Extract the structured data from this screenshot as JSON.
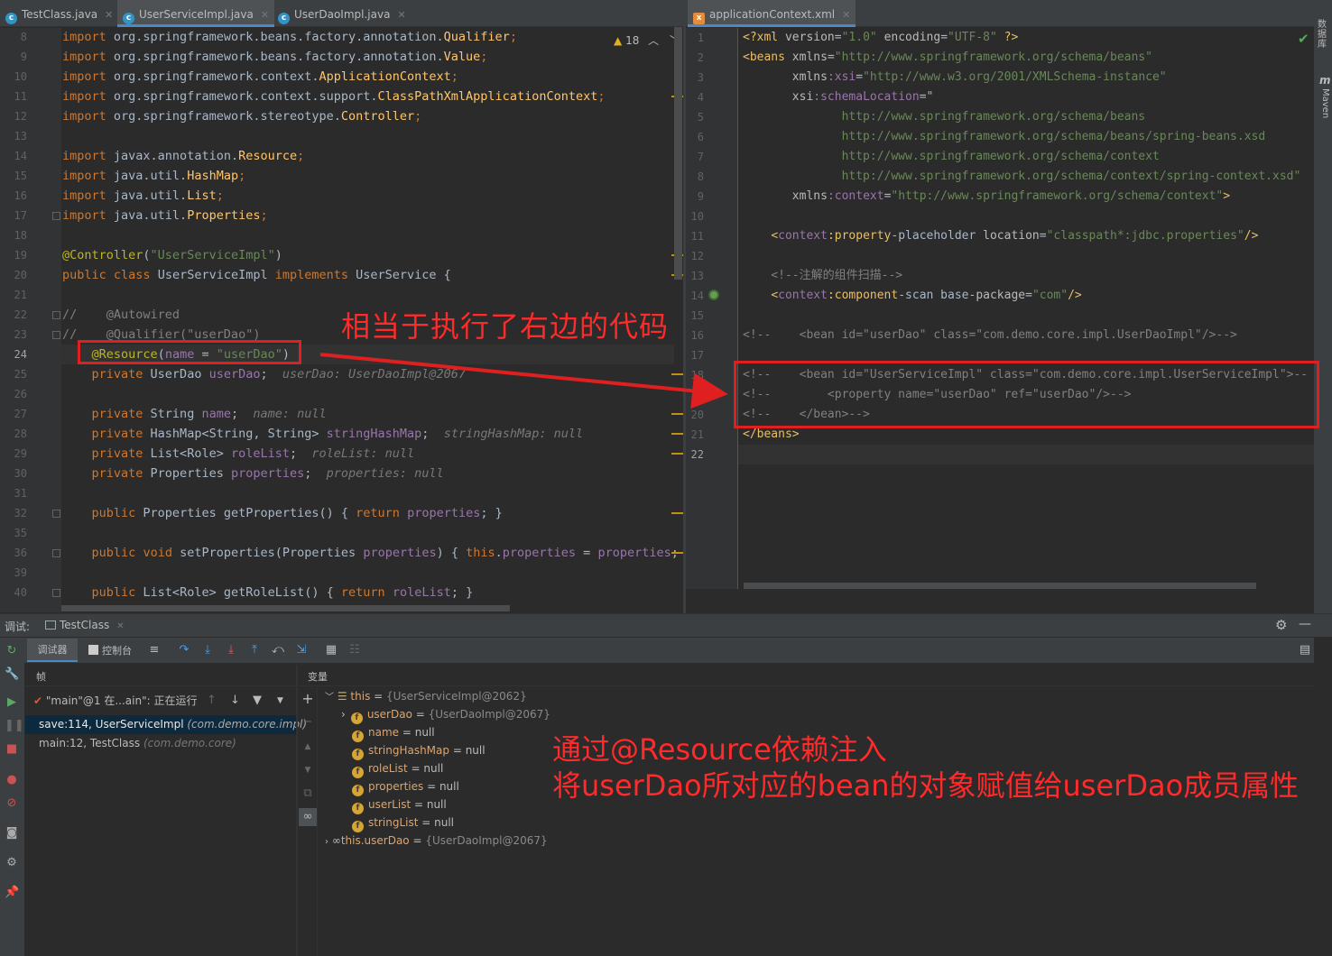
{
  "left_tabs": [
    {
      "label": "TestClass.java",
      "icon": "class-icon"
    },
    {
      "label": "UserServiceImpl.java",
      "icon": "class-icon",
      "active": true
    },
    {
      "label": "UserDaoImpl.java",
      "icon": "class-icon"
    }
  ],
  "right_tabs": [
    {
      "label": "applicationContext.xml",
      "icon": "xml-icon",
      "active": true
    }
  ],
  "warning_count": "18",
  "left_lines": [
    {
      "n": "8",
      "code": "import org.springframework.beans.factory.annotation.Qualifier;"
    },
    {
      "n": "9",
      "code": "import org.springframework.beans.factory.annotation.Value;"
    },
    {
      "n": "10",
      "code": "import org.springframework.context.ApplicationContext;"
    },
    {
      "n": "11",
      "code": "import org.springframework.context.support.ClassPathXmlApplicationContext;"
    },
    {
      "n": "12",
      "code": "import org.springframework.stereotype.Controller;"
    },
    {
      "n": "13",
      "code": ""
    },
    {
      "n": "14",
      "code": "import javax.annotation.Resource;"
    },
    {
      "n": "15",
      "code": "import java.util.HashMap;"
    },
    {
      "n": "16",
      "code": "import java.util.List;"
    },
    {
      "n": "17",
      "code": "import java.util.Properties;"
    },
    {
      "n": "18",
      "code": ""
    },
    {
      "n": "19",
      "code": "@Controller(\"UserServiceImpl\")"
    },
    {
      "n": "20",
      "code": "public class UserServiceImpl implements UserService {"
    },
    {
      "n": "21",
      "code": ""
    },
    {
      "n": "22",
      "code": "//    @Autowired"
    },
    {
      "n": "23",
      "code": "//    @Qualifier(\"userDao\")"
    },
    {
      "n": "24",
      "code": "    @Resource(name = \"userDao\")"
    },
    {
      "n": "25",
      "code": "    private UserDao userDao;",
      "hint": "userDao: UserDaoImpl@2067"
    },
    {
      "n": "26",
      "code": ""
    },
    {
      "n": "27",
      "code": "    private String name;",
      "hint": "name: null"
    },
    {
      "n": "28",
      "code": "    private HashMap<String, String> stringHashMap;",
      "hint": "stringHashMap: null"
    },
    {
      "n": "29",
      "code": "    private List<Role> roleList;",
      "hint": "roleList: null"
    },
    {
      "n": "30",
      "code": "    private Properties properties;",
      "hint": "properties: null"
    },
    {
      "n": "31",
      "code": ""
    },
    {
      "n": "32",
      "code": "    public Properties getProperties() { return properties; }"
    },
    {
      "n": "35",
      "code": ""
    },
    {
      "n": "36",
      "code": "    public void setProperties(Properties properties) { this.properties = properties; }"
    },
    {
      "n": "39",
      "code": ""
    },
    {
      "n": "40",
      "code": "    public List<Role> getRoleList() { return roleList; }"
    }
  ],
  "right_lines": [
    {
      "n": "1",
      "code": "<?xml version=\"1.0\" encoding=\"UTF-8\" ?>"
    },
    {
      "n": "2",
      "code": "<beans xmlns=\"http://www.springframework.org/schema/beans\""
    },
    {
      "n": "3",
      "code": "       xmlns:xsi=\"http://www.w3.org/2001/XMLSchema-instance\""
    },
    {
      "n": "4",
      "code": "       xsi:schemaLocation=\""
    },
    {
      "n": "5",
      "code": "              http://www.springframework.org/schema/beans"
    },
    {
      "n": "6",
      "code": "              http://www.springframework.org/schema/beans/spring-beans.xsd"
    },
    {
      "n": "7",
      "code": "              http://www.springframework.org/schema/context"
    },
    {
      "n": "8",
      "code": "              http://www.springframework.org/schema/context/spring-context.xsd\""
    },
    {
      "n": "9",
      "code": "       xmlns:context=\"http://www.springframework.org/schema/context\">"
    },
    {
      "n": "10",
      "code": ""
    },
    {
      "n": "11",
      "code": "    <context:property-placeholder location=\"classpath*:jdbc.properties\"/>"
    },
    {
      "n": "12",
      "code": ""
    },
    {
      "n": "13",
      "code": "    <!--注解的组件扫描-->"
    },
    {
      "n": "14",
      "code": "    <context:component-scan base-package=\"com\"/>"
    },
    {
      "n": "15",
      "code": ""
    },
    {
      "n": "16",
      "code": "<!--    <bean id=\"userDao\" class=\"com.demo.core.impl.UserDaoImpl\"/>-->"
    },
    {
      "n": "17",
      "code": ""
    },
    {
      "n": "18",
      "code": "<!--    <bean id=\"UserServiceImpl\" class=\"com.demo.core.impl.UserServiceImpl\">--"
    },
    {
      "n": "19",
      "code": "<!--        <property name=\"userDao\" ref=\"userDao\"/>-->"
    },
    {
      "n": "20",
      "code": "<!--    </bean>-->"
    },
    {
      "n": "21",
      "code": "</beans>"
    },
    {
      "n": "22",
      "code": ""
    }
  ],
  "annotation_top": "相当于执行了右边的代码",
  "annotation_bottom_1": "通过@Resource依赖注入",
  "annotation_bottom_2": "将userDao所对应的bean的对象赋值给userDao成员属性",
  "side_labels": {
    "database": "数据库",
    "maven": "Maven"
  },
  "debug": {
    "title": "调试:",
    "session_tab": "TestClass",
    "tab_debugger": "调试器",
    "tab_console": "控制台",
    "frames_header": "帧",
    "vars_header": "变量",
    "thread": "\"main\"@1 在...ain\": 正在运行",
    "frames": [
      {
        "method": "save:114, UserServiceImpl",
        "pkg": "(com.demo.core.impl)",
        "selected": true
      },
      {
        "method": "main:12, TestClass",
        "pkg": "(com.demo.core)"
      }
    ],
    "this_var": {
      "name": "this",
      "value": "{UserServiceImpl@2062}"
    },
    "fields": [
      {
        "name": "userDao",
        "value": "{UserDaoImpl@2067}",
        "expandable": true
      },
      {
        "name": "name",
        "value": "null"
      },
      {
        "name": "stringHashMap",
        "value": "null"
      },
      {
        "name": "roleList",
        "value": "null"
      },
      {
        "name": "properties",
        "value": "null"
      },
      {
        "name": "userList",
        "value": "null"
      },
      {
        "name": "stringList",
        "value": "null"
      }
    ],
    "watch": {
      "name": "this.userDao",
      "value": "{UserDaoImpl@2067}"
    }
  }
}
